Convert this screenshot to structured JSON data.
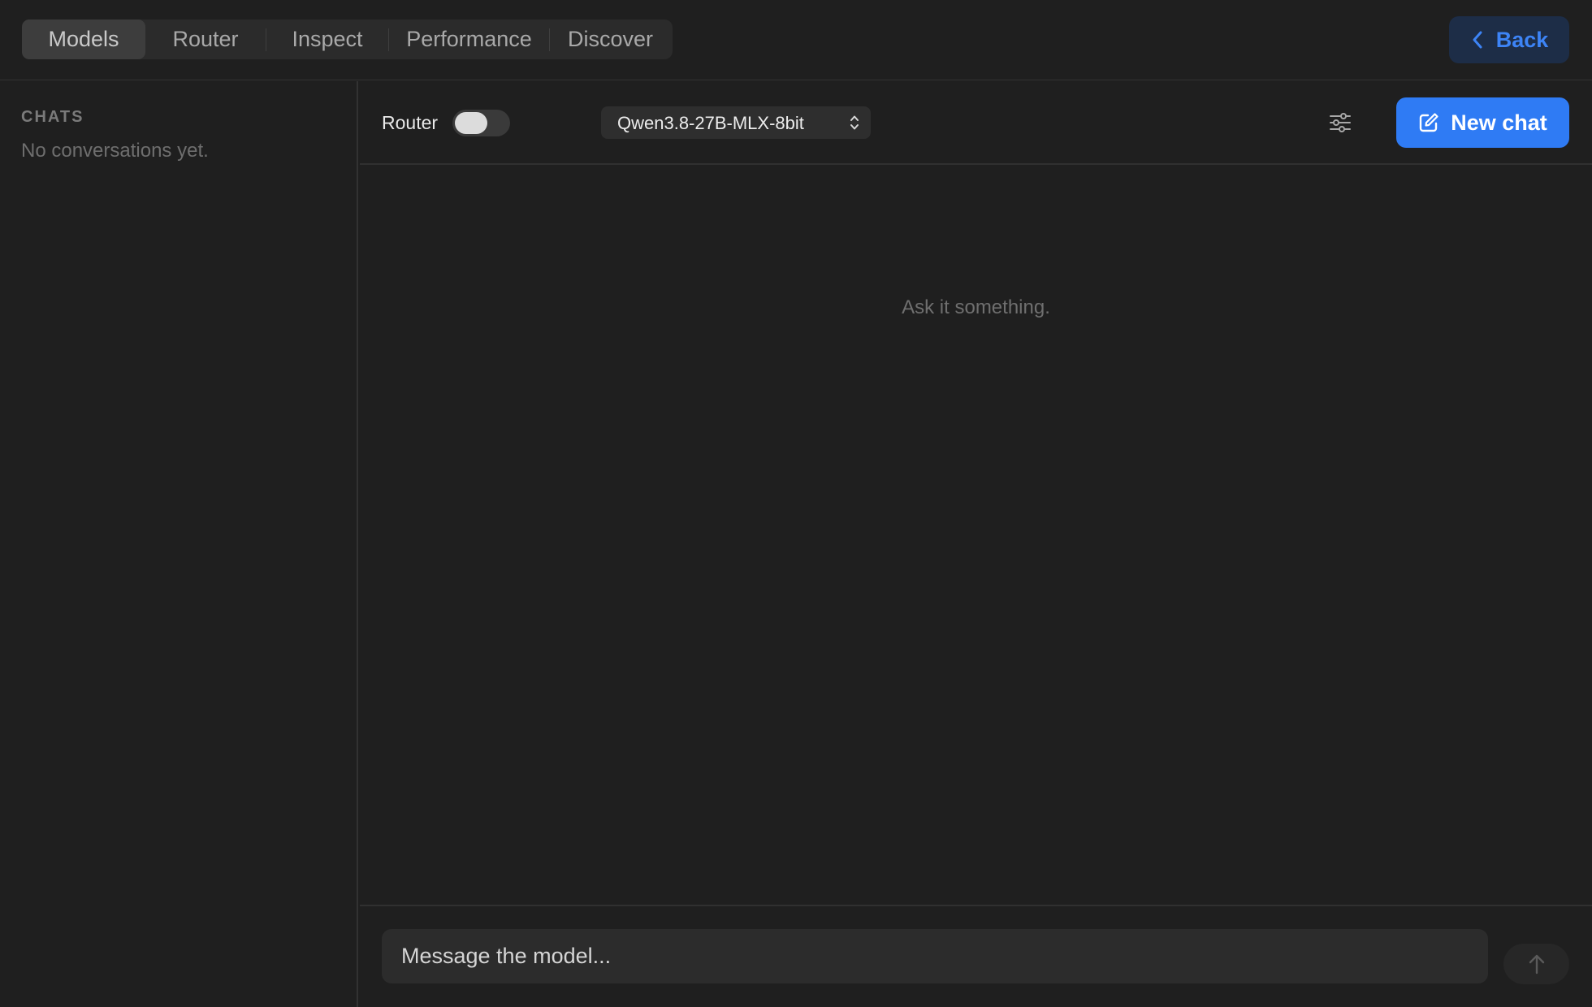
{
  "nav": {
    "tabs": [
      {
        "label": "Models",
        "active": true
      },
      {
        "label": "Router",
        "active": false
      },
      {
        "label": "Inspect",
        "active": false
      },
      {
        "label": "Performance",
        "active": false
      },
      {
        "label": "Discover",
        "active": false
      }
    ],
    "back_label": "Back"
  },
  "sidebar": {
    "heading": "CHATS",
    "empty_text": "No conversations yet."
  },
  "chat_header": {
    "router_label": "Router",
    "router_enabled": false,
    "model_selected": "Qwen3.8-27B-MLX-8bit",
    "new_chat_label": "New chat"
  },
  "chat": {
    "empty_hint": "Ask it something."
  },
  "composer": {
    "placeholder": "Message the model..."
  },
  "colors": {
    "background": "#1f1f1f",
    "accent": "#2f7bf4",
    "back_text": "#3d84f6",
    "back_bg": "#1d2d47"
  },
  "icons": {
    "back": "chevron-left-icon",
    "select": "chevron-up-down-icon",
    "settings": "sliders-icon",
    "new_chat": "compose-icon",
    "send": "arrow-up-icon"
  }
}
